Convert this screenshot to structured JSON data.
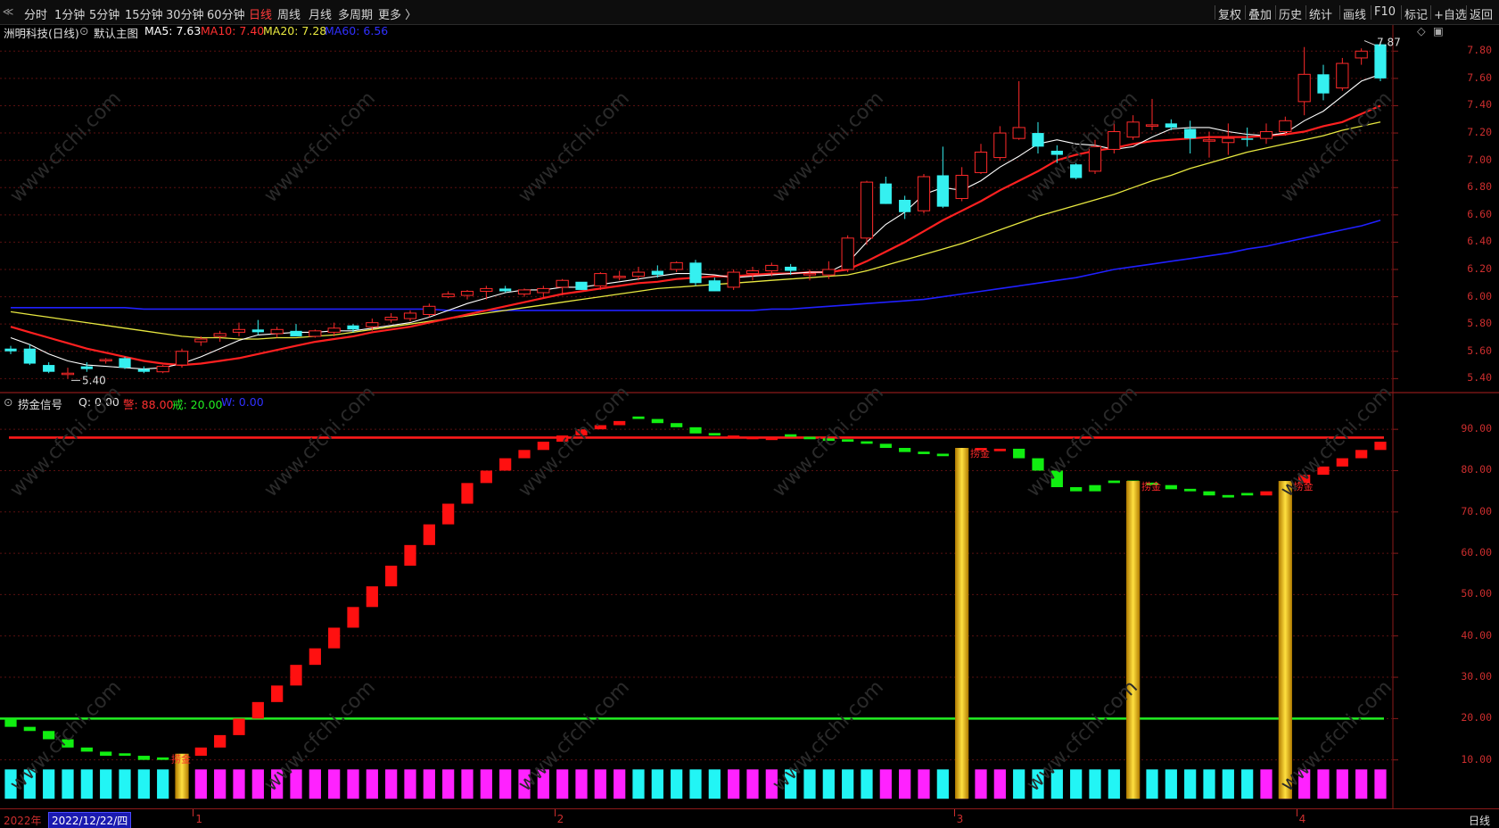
{
  "toolbar": {
    "back_glyph": "≪",
    "periods": [
      "分时",
      "1分钟",
      "5分钟",
      "15分钟",
      "30分钟",
      "60分钟",
      "日线",
      "周线",
      "月线",
      "多周期",
      "更多 〉"
    ],
    "active_period": "日线",
    "right_buttons": [
      "复权",
      "叠加",
      "历史",
      "统计",
      "画线",
      "F10",
      "标记",
      "+自选",
      "返回"
    ]
  },
  "main_panel": {
    "stock_title": "洲明科技(日线)",
    "template_label": "默认主图",
    "ma5": "MA5: 7.63",
    "ma10": "MA10: 7.40",
    "ma20": "MA20: 7.28",
    "ma60": "MA60: 6.56",
    "high_marker": "7.87",
    "low_marker": "5.40",
    "y_labels": [
      "7.80",
      "7.60",
      "7.40",
      "7.20",
      "7.00",
      "6.80",
      "6.60",
      "6.40",
      "6.20",
      "6.00",
      "5.80",
      "5.60",
      "5.40"
    ]
  },
  "indicator_panel": {
    "name": "捞金信号",
    "q": "Q: 0.00",
    "warn_label": "警: 88.00",
    "caution_label": "戒: 20.00",
    "w_label": "W: 0.00",
    "signal_label": "捞金",
    "y_labels": [
      "90.00",
      "80.00",
      "70.00",
      "60.00",
      "50.00",
      "40.00",
      "30.00",
      "20.00",
      "10.00"
    ]
  },
  "bottom": {
    "year_label": "2022年",
    "cursor_date": "2022/12/22/四",
    "months": [
      "1",
      "2",
      "3",
      "4"
    ],
    "period": "日线"
  },
  "colors": {
    "up": "#ff2a2a",
    "down": "#35f0f0",
    "ma5": "#ffffff",
    "ma10": "#ff2020",
    "ma20": "#e8e840",
    "ma60": "#2020ff",
    "osc_up": "#ff1010",
    "osc_down": "#11ee11",
    "vol_cyan": "#22f5f5",
    "vol_magenta": "#ff22ff",
    "gold": "#f2c200",
    "grid": "#5a1010"
  },
  "chart_data": [
    {
      "type": "candlestick",
      "title": "洲明科技(日线)",
      "ylim": [
        5.35,
        7.9
      ],
      "ohlc": [
        [
          5.62,
          5.64,
          5.58,
          5.6
        ],
        [
          5.62,
          5.65,
          5.5,
          5.51
        ],
        [
          5.5,
          5.52,
          5.44,
          5.45
        ],
        [
          5.43,
          5.48,
          5.4,
          5.44
        ],
        [
          5.49,
          5.52,
          5.45,
          5.47
        ],
        [
          5.53,
          5.55,
          5.51,
          5.54
        ],
        [
          5.55,
          5.56,
          5.47,
          5.48
        ],
        [
          5.47,
          5.49,
          5.44,
          5.45
        ],
        [
          5.45,
          5.5,
          5.44,
          5.49
        ],
        [
          5.5,
          5.62,
          5.48,
          5.6
        ],
        [
          5.67,
          5.71,
          5.64,
          5.69
        ],
        [
          5.71,
          5.75,
          5.67,
          5.73
        ],
        [
          5.74,
          5.81,
          5.71,
          5.76
        ],
        [
          5.76,
          5.83,
          5.72,
          5.74
        ],
        [
          5.73,
          5.78,
          5.7,
          5.76
        ],
        [
          5.75,
          5.8,
          5.72,
          5.71
        ],
        [
          5.71,
          5.76,
          5.7,
          5.75
        ],
        [
          5.74,
          5.81,
          5.71,
          5.77
        ],
        [
          5.79,
          5.8,
          5.74,
          5.76
        ],
        [
          5.78,
          5.84,
          5.75,
          5.81
        ],
        [
          5.83,
          5.88,
          5.81,
          5.85
        ],
        [
          5.84,
          5.9,
          5.82,
          5.88
        ],
        [
          5.87,
          5.95,
          5.85,
          5.93
        ],
        [
          6.0,
          6.04,
          5.99,
          6.02
        ],
        [
          6.01,
          6.05,
          5.98,
          6.04
        ],
        [
          6.04,
          6.08,
          5.98,
          6.06
        ],
        [
          6.06,
          6.08,
          6.03,
          6.04
        ],
        [
          6.02,
          6.06,
          6.0,
          6.05
        ],
        [
          6.03,
          6.08,
          5.99,
          6.06
        ],
        [
          6.07,
          6.13,
          6.01,
          6.12
        ],
        [
          6.11,
          6.1,
          6.05,
          6.05
        ],
        [
          6.08,
          6.18,
          6.05,
          6.17
        ],
        [
          6.15,
          6.19,
          6.12,
          6.15
        ],
        [
          6.15,
          6.22,
          6.12,
          6.18
        ],
        [
          6.19,
          6.23,
          6.14,
          6.16
        ],
        [
          6.2,
          6.26,
          6.18,
          6.25
        ],
        [
          6.25,
          6.27,
          6.08,
          6.1
        ],
        [
          6.12,
          6.14,
          6.04,
          6.04
        ],
        [
          6.07,
          6.2,
          6.05,
          6.18
        ],
        [
          6.17,
          6.22,
          6.12,
          6.19
        ],
        [
          6.19,
          6.25,
          6.15,
          6.23
        ],
        [
          6.22,
          6.24,
          6.16,
          6.19
        ],
        [
          6.16,
          6.2,
          6.12,
          6.17
        ],
        [
          6.16,
          6.26,
          6.13,
          6.2
        ],
        [
          6.2,
          6.45,
          6.18,
          6.43
        ],
        [
          6.43,
          6.85,
          6.38,
          6.84
        ],
        [
          6.83,
          6.88,
          6.68,
          6.68
        ],
        [
          6.71,
          6.74,
          6.57,
          6.62
        ],
        [
          6.63,
          6.9,
          6.61,
          6.88
        ],
        [
          6.89,
          7.1,
          6.65,
          6.66
        ],
        [
          6.72,
          6.95,
          6.7,
          6.89
        ],
        [
          6.91,
          7.12,
          6.9,
          7.06
        ],
        [
          7.02,
          7.25,
          7.0,
          7.2
        ],
        [
          7.16,
          7.58,
          7.15,
          7.24
        ],
        [
          7.2,
          7.28,
          7.05,
          7.1
        ],
        [
          7.07,
          7.11,
          6.98,
          7.04
        ],
        [
          6.97,
          6.98,
          6.86,
          6.87
        ],
        [
          6.92,
          7.15,
          6.9,
          7.1
        ],
        [
          7.08,
          7.29,
          7.05,
          7.21
        ],
        [
          7.17,
          7.33,
          7.15,
          7.28
        ],
        [
          7.25,
          7.45,
          7.22,
          7.26
        ],
        [
          7.27,
          7.3,
          7.22,
          7.24
        ],
        [
          7.23,
          7.29,
          7.05,
          7.16
        ],
        [
          7.14,
          7.21,
          7.02,
          7.15
        ],
        [
          7.13,
          7.27,
          7.04,
          7.16
        ],
        [
          7.16,
          7.24,
          7.1,
          7.15
        ],
        [
          7.16,
          7.27,
          7.12,
          7.21
        ],
        [
          7.21,
          7.32,
          7.18,
          7.29
        ],
        [
          7.43,
          7.83,
          7.33,
          7.63
        ],
        [
          7.63,
          7.7,
          7.44,
          7.49
        ],
        [
          7.53,
          7.75,
          7.51,
          7.71
        ],
        [
          7.75,
          7.82,
          7.7,
          7.8
        ],
        [
          7.85,
          7.87,
          7.58,
          7.6
        ]
      ],
      "ma5": [
        5.7,
        5.65,
        5.58,
        5.53,
        5.5,
        5.49,
        5.48,
        5.47,
        5.48,
        5.51,
        5.56,
        5.62,
        5.68,
        5.72,
        5.73,
        5.74,
        5.74,
        5.75,
        5.75,
        5.77,
        5.79,
        5.81,
        5.85,
        5.9,
        5.95,
        5.99,
        6.03,
        6.05,
        6.05,
        6.07,
        6.07,
        6.09,
        6.11,
        6.13,
        6.15,
        6.17,
        6.17,
        6.16,
        6.14,
        6.15,
        6.16,
        6.17,
        6.18,
        6.18,
        6.25,
        6.4,
        6.53,
        6.62,
        6.75,
        6.8,
        6.78,
        6.85,
        6.95,
        7.03,
        7.12,
        7.15,
        7.12,
        7.11,
        7.08,
        7.1,
        7.17,
        7.23,
        7.24,
        7.24,
        7.21,
        7.19,
        7.18,
        7.2,
        7.29,
        7.36,
        7.47,
        7.58,
        7.63
      ],
      "ma10": [
        5.78,
        5.74,
        5.7,
        5.66,
        5.62,
        5.59,
        5.56,
        5.53,
        5.51,
        5.5,
        5.51,
        5.53,
        5.55,
        5.58,
        5.61,
        5.64,
        5.67,
        5.69,
        5.71,
        5.74,
        5.76,
        5.78,
        5.81,
        5.84,
        5.87,
        5.9,
        5.93,
        5.96,
        5.99,
        6.02,
        6.04,
        6.06,
        6.08,
        6.1,
        6.11,
        6.13,
        6.14,
        6.15,
        6.15,
        6.16,
        6.17,
        6.17,
        6.18,
        6.18,
        6.2,
        6.26,
        6.33,
        6.4,
        6.48,
        6.56,
        6.63,
        6.7,
        6.78,
        6.85,
        6.92,
        7.0,
        7.04,
        7.07,
        7.09,
        7.12,
        7.14,
        7.15,
        7.16,
        7.17,
        7.17,
        7.17,
        7.18,
        7.19,
        7.21,
        7.25,
        7.28,
        7.34,
        7.4
      ],
      "ma20": [
        5.89,
        5.87,
        5.85,
        5.83,
        5.81,
        5.79,
        5.77,
        5.75,
        5.73,
        5.71,
        5.7,
        5.7,
        5.69,
        5.69,
        5.7,
        5.7,
        5.71,
        5.72,
        5.74,
        5.76,
        5.78,
        5.8,
        5.82,
        5.84,
        5.86,
        5.88,
        5.9,
        5.92,
        5.94,
        5.96,
        5.98,
        6.0,
        6.02,
        6.04,
        6.06,
        6.07,
        6.08,
        6.09,
        6.1,
        6.11,
        6.12,
        6.13,
        6.14,
        6.15,
        6.16,
        6.19,
        6.23,
        6.27,
        6.31,
        6.35,
        6.39,
        6.44,
        6.49,
        6.54,
        6.59,
        6.63,
        6.67,
        6.71,
        6.75,
        6.8,
        6.85,
        6.89,
        6.94,
        6.98,
        7.02,
        7.06,
        7.09,
        7.12,
        7.15,
        7.18,
        7.22,
        7.25,
        7.28
      ],
      "ma60": [
        5.92,
        5.92,
        5.92,
        5.92,
        5.92,
        5.92,
        5.92,
        5.91,
        5.91,
        5.91,
        5.91,
        5.91,
        5.91,
        5.91,
        5.91,
        5.91,
        5.91,
        5.91,
        5.91,
        5.91,
        5.91,
        5.91,
        5.91,
        5.9,
        5.9,
        5.9,
        5.9,
        5.9,
        5.9,
        5.9,
        5.9,
        5.9,
        5.9,
        5.9,
        5.9,
        5.9,
        5.9,
        5.9,
        5.9,
        5.9,
        5.91,
        5.91,
        5.92,
        5.93,
        5.94,
        5.95,
        5.96,
        5.97,
        5.98,
        6.0,
        6.02,
        6.04,
        6.06,
        6.08,
        6.1,
        6.12,
        6.14,
        6.17,
        6.2,
        6.22,
        6.24,
        6.26,
        6.28,
        6.3,
        6.32,
        6.35,
        6.37,
        6.4,
        6.43,
        6.46,
        6.49,
        6.52,
        6.56
      ]
    },
    {
      "type": "bar",
      "title": "捞金信号",
      "ylim": [
        0,
        95
      ],
      "warn_line": 88,
      "caution_line": 20,
      "osc_values": [
        18,
        17,
        15,
        13,
        12,
        11,
        11,
        10,
        10,
        11,
        13,
        16,
        20,
        24,
        28,
        33,
        37,
        42,
        47,
        52,
        57,
        62,
        67,
        72,
        77,
        80,
        83,
        85,
        87,
        88.5,
        90,
        91,
        92,
        92.5,
        91.5,
        90.5,
        89,
        88.5,
        88.5,
        88.2,
        88,
        88.2,
        87.6,
        87.2,
        87,
        86.5,
        85.5,
        84.5,
        84,
        83.5,
        85,
        85.5,
        85.3,
        83,
        80,
        76,
        75,
        76.5,
        77,
        77,
        76.5,
        75.5,
        75,
        74,
        73.5,
        74,
        75,
        77,
        79,
        81,
        83,
        85,
        87
      ],
      "osc_dir": [
        "d",
        "d",
        "d",
        "d",
        "d",
        "d",
        "d",
        "d",
        "d",
        "u",
        "u",
        "u",
        "u",
        "u",
        "u",
        "u",
        "u",
        "u",
        "u",
        "u",
        "u",
        "u",
        "u",
        "u",
        "u",
        "u",
        "u",
        "u",
        "u",
        "u",
        "u",
        "u",
        "u",
        "d",
        "d",
        "d",
        "d",
        "d",
        "u",
        "u",
        "u",
        "d",
        "d",
        "d",
        "d",
        "d",
        "d",
        "d",
        "d",
        "d",
        "u",
        "u",
        "u",
        "d",
        "d",
        "d",
        "d",
        "d",
        "d",
        "d",
        "d",
        "d",
        "d",
        "d",
        "d",
        "d",
        "u",
        "u",
        "u",
        "u",
        "u",
        "u",
        "u"
      ],
      "volume_colors": [
        "c",
        "c",
        "c",
        "c",
        "c",
        "c",
        "c",
        "c",
        "c",
        "m",
        "m",
        "m",
        "m",
        "m",
        "m",
        "m",
        "m",
        "m",
        "m",
        "m",
        "m",
        "m",
        "m",
        "m",
        "m",
        "m",
        "m",
        "m",
        "m",
        "m",
        "m",
        "m",
        "m",
        "c",
        "c",
        "c",
        "c",
        "c",
        "m",
        "m",
        "m",
        "c",
        "c",
        "c",
        "c",
        "c",
        "m",
        "m",
        "m",
        "c",
        "m",
        "m",
        "m",
        "c",
        "c",
        "c",
        "c",
        "c",
        "c",
        "c",
        "c",
        "c",
        "c",
        "c",
        "c",
        "c",
        "m",
        "m",
        "m",
        "m",
        "m",
        "m",
        "m"
      ],
      "gold_signals": [
        9,
        50,
        59,
        67
      ],
      "gold_labels": [
        9,
        51,
        60,
        68
      ]
    }
  ]
}
